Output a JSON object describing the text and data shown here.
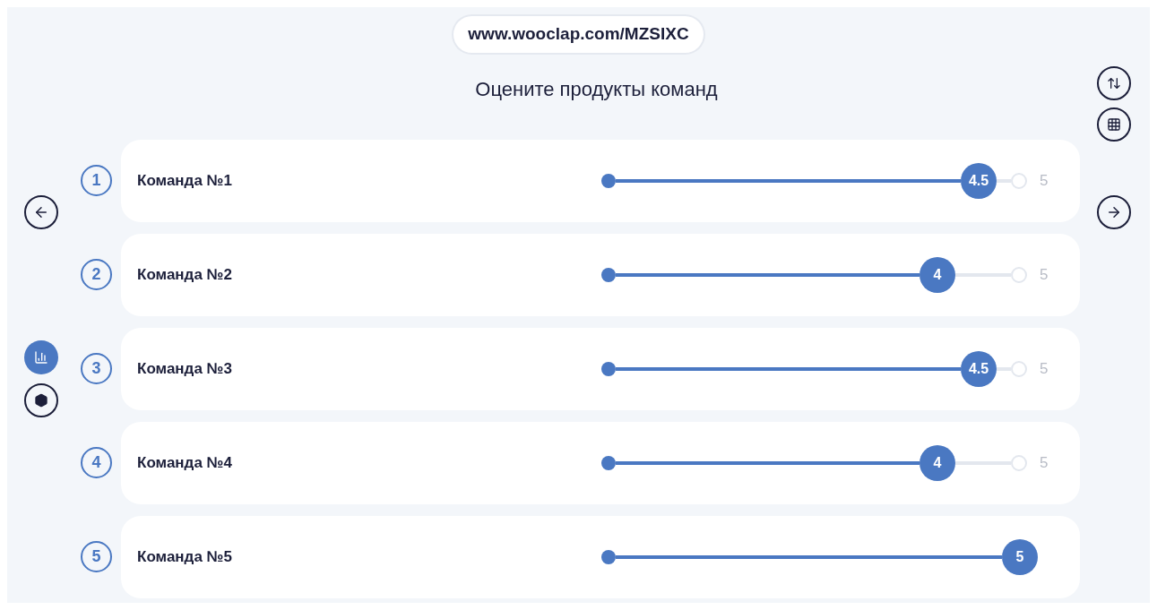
{
  "url": "www.wooclap.com/MZSIXC",
  "title": "Оцените продукты команд",
  "left_tools": [
    {
      "kind": "chart",
      "selected": true
    },
    {
      "kind": "hexagon",
      "selected": false
    }
  ],
  "rows": [
    {
      "number": "1",
      "name": "Команда №1",
      "level": 0.9,
      "value": "4.5",
      "max_label": "5"
    },
    {
      "number": "2",
      "name": "Команда №2",
      "level": 0.8,
      "value": "4",
      "max_label": "5"
    },
    {
      "number": "3",
      "name": "Команда №3",
      "level": 0.9,
      "value": "4.5",
      "max_label": "5"
    },
    {
      "number": "4",
      "name": "Команда №4",
      "level": 0.8,
      "value": "4",
      "max_label": "5"
    },
    {
      "number": "5",
      "name": "Команда №5",
      "level": 1,
      "value": "5"
    }
  ]
}
